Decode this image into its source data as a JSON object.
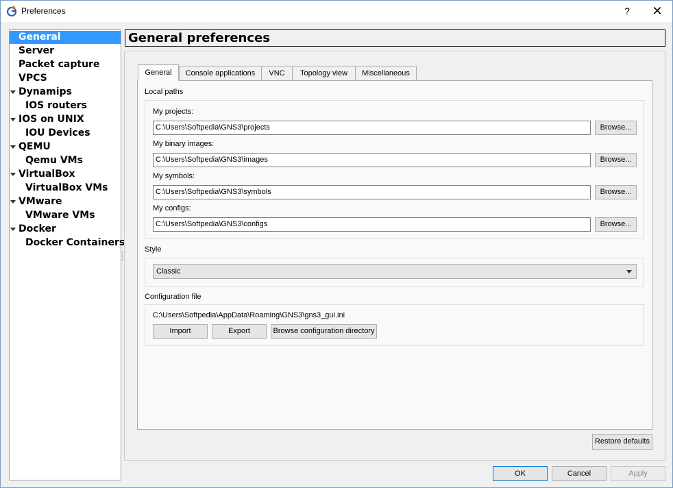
{
  "window": {
    "title": "Preferences",
    "help_glyph": "?",
    "close_glyph": "✕"
  },
  "sidebar": {
    "items": [
      {
        "label": "General",
        "level": 0,
        "expandable": false,
        "selected": true
      },
      {
        "label": "Server",
        "level": 0,
        "expandable": false
      },
      {
        "label": "Packet capture",
        "level": 0,
        "expandable": false
      },
      {
        "label": "VPCS",
        "level": 0,
        "expandable": false
      },
      {
        "label": "Dynamips",
        "level": 0,
        "expandable": true
      },
      {
        "label": "IOS routers",
        "level": 1,
        "expandable": false
      },
      {
        "label": "IOS on UNIX",
        "level": 0,
        "expandable": true
      },
      {
        "label": "IOU Devices",
        "level": 1,
        "expandable": false
      },
      {
        "label": "QEMU",
        "level": 0,
        "expandable": true
      },
      {
        "label": "Qemu VMs",
        "level": 1,
        "expandable": false
      },
      {
        "label": "VirtualBox",
        "level": 0,
        "expandable": true
      },
      {
        "label": "VirtualBox VMs",
        "level": 1,
        "expandable": false
      },
      {
        "label": "VMware",
        "level": 0,
        "expandable": true
      },
      {
        "label": "VMware VMs",
        "level": 1,
        "expandable": false
      },
      {
        "label": "Docker",
        "level": 0,
        "expandable": true
      },
      {
        "label": "Docker Containers",
        "level": 1,
        "expandable": false
      }
    ]
  },
  "panel": {
    "title": "General preferences"
  },
  "tabs": [
    {
      "label": "General",
      "active": true
    },
    {
      "label": "Console applications"
    },
    {
      "label": "VNC"
    },
    {
      "label": "Topology view"
    },
    {
      "label": "Miscellaneous"
    }
  ],
  "local_paths": {
    "group_label": "Local paths",
    "projects_label": "My projects:",
    "projects_value": "C:\\Users\\Softpedia\\GNS3\\projects",
    "images_label": "My binary images:",
    "images_value": "C:\\Users\\Softpedia\\GNS3\\images",
    "symbols_label": "My symbols:",
    "symbols_value": "C:\\Users\\Softpedia\\GNS3\\symbols",
    "configs_label": "My configs:",
    "configs_value": "C:\\Users\\Softpedia\\GNS3\\configs",
    "browse_label": "Browse..."
  },
  "style": {
    "group_label": "Style",
    "selected": "Classic"
  },
  "configuration_file": {
    "group_label": "Configuration file",
    "path": "C:\\Users\\Softpedia\\AppData\\Roaming\\GNS3\\gns3_gui.ini",
    "import_label": "Import",
    "export_label": "Export",
    "browse_dir_label": "Browse configuration directory"
  },
  "footer": {
    "restore_label": "Restore defaults",
    "ok_label": "OK",
    "cancel_label": "Cancel",
    "apply_label": "Apply"
  },
  "colors": {
    "selection": "#3399ff",
    "default_button_border": "#0078d7"
  }
}
